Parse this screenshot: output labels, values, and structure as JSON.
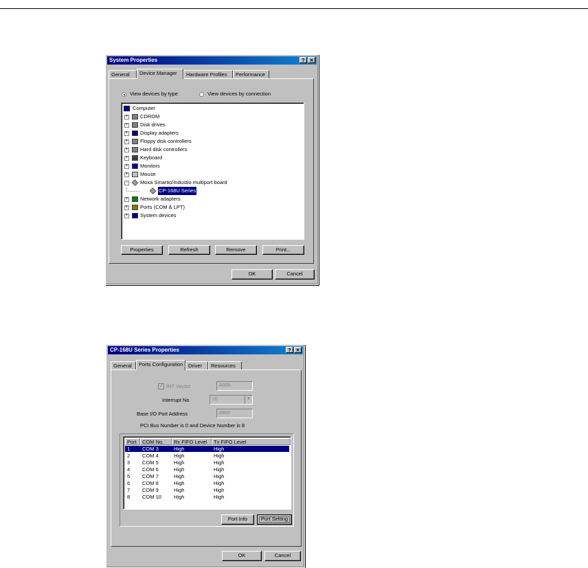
{
  "dialog1": {
    "title": "System Properties",
    "help": "?",
    "close": "✕",
    "tabs": [
      "General",
      "Device Manager",
      "Hardware Profiles",
      "Performance"
    ],
    "radio_type": "View devices by type",
    "radio_connection": "View devices by connection",
    "tree": {
      "root": "Computer",
      "items": [
        {
          "label": "CDROM",
          "icon": "cdrom-icon",
          "expander": "+"
        },
        {
          "label": "Disk drives",
          "icon": "disk-drive-icon",
          "expander": "+"
        },
        {
          "label": "Display adapters",
          "icon": "display-adapter-icon",
          "expander": "+"
        },
        {
          "label": "Floppy disk controllers",
          "icon": "floppy-controller-icon",
          "expander": "+"
        },
        {
          "label": "Hard disk controllers",
          "icon": "hard-disk-controller-icon",
          "expander": "+"
        },
        {
          "label": "Keyboard",
          "icon": "keyboard-icon",
          "expander": "+"
        },
        {
          "label": "Monitors",
          "icon": "monitor-icon",
          "expander": "+"
        },
        {
          "label": "Mouse",
          "icon": "mouse-icon",
          "expander": "+"
        },
        {
          "label": "Moxa Smartio/Industio multiport board",
          "icon": "multiport-board-icon",
          "expander": "−"
        },
        {
          "label": "CP-168U Series",
          "icon": "multiport-board-icon",
          "child": true,
          "selected": true
        },
        {
          "label": "Network adapters",
          "icon": "network-adapter-icon",
          "expander": "+"
        },
        {
          "label": "Ports (COM & LPT)",
          "icon": "port-icon",
          "expander": "+"
        },
        {
          "label": "System devices",
          "icon": "system-device-icon",
          "expander": "+"
        }
      ]
    },
    "buttons": {
      "properties": "Properties",
      "refresh": "Refresh",
      "remove": "Remove",
      "print": "Print...",
      "ok": "OK",
      "cancel": "Cancel"
    }
  },
  "dialog2": {
    "title": "CP-168U Series Properties",
    "help": "?",
    "close": "✕",
    "tabs": [
      "General",
      "Ports Configuration",
      "Driver",
      "Resources"
    ],
    "int_vector_label": "INT Vector",
    "int_vector_value": "A000",
    "interrupt_label": "Interrupt No",
    "interrupt_value": "10",
    "base_io_label": "Base I/O Port Address",
    "base_io_value": "A800",
    "pci_info": "PCI Bus Number is 0 and Device Number is 8",
    "columns": [
      "Port",
      "COM No.",
      "Rx FIFO Level",
      "Tx FIFO Level"
    ],
    "rows": [
      [
        "1",
        "COM 3",
        "High",
        "High"
      ],
      [
        "2",
        "COM 4",
        "High",
        "High"
      ],
      [
        "3",
        "COM 5",
        "High",
        "High"
      ],
      [
        "4",
        "COM 6",
        "High",
        "High"
      ],
      [
        "5",
        "COM 7",
        "High",
        "High"
      ],
      [
        "6",
        "COM 8",
        "High",
        "High"
      ],
      [
        "7",
        "COM 9",
        "High",
        "High"
      ],
      [
        "8",
        "COM 10",
        "High",
        "High"
      ]
    ],
    "buttons": {
      "port_info": "Port Info",
      "port_setting": "Port Setting",
      "ok": "OK",
      "cancel": "Cancel"
    }
  }
}
